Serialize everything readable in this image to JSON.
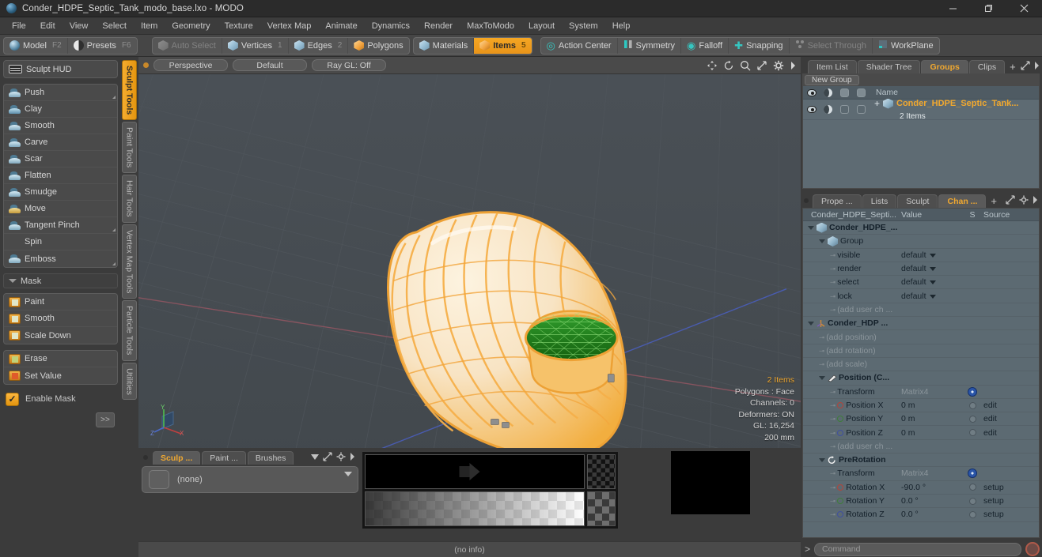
{
  "window": {
    "title": "Conder_HDPE_Septic_Tank_modo_base.lxo - MODO",
    "app_icon": "modo-sphere-icon",
    "minimize": "minimize-icon",
    "maximize": "restore-icon",
    "close": "close-icon"
  },
  "menubar": {
    "items": [
      "File",
      "Edit",
      "View",
      "Select",
      "Item",
      "Geometry",
      "Texture",
      "Vertex Map",
      "Animate",
      "Dynamics",
      "Render",
      "MaxToModo",
      "Layout",
      "System",
      "Help"
    ]
  },
  "modebar": {
    "group1": [
      {
        "label": "Model",
        "hotkey": "F2",
        "icon": "sphere-icon",
        "active": false
      },
      {
        "label": "Presets",
        "hotkey": "F6",
        "icon": "half-sphere-icon",
        "active": false
      }
    ],
    "group2": [
      {
        "label": "Auto Select",
        "hotkey": "",
        "icon": "cube-grey-icon",
        "dim": true
      },
      {
        "label": "Vertices",
        "hotkey": "1",
        "icon": "cube-icon"
      },
      {
        "label": "Edges",
        "hotkey": "2",
        "icon": "cube-icon"
      },
      {
        "label": "Polygons",
        "hotkey": "",
        "icon": "cube-orange-icon"
      }
    ],
    "group3": [
      {
        "label": "Materials",
        "hotkey": "",
        "icon": "cube-icon"
      },
      {
        "label": "Items",
        "hotkey": "5",
        "icon": "cube-orange-icon",
        "active": true
      }
    ],
    "group4": [
      {
        "label": "Action Center",
        "icon": "crosshair-icon"
      },
      {
        "label": "Symmetry",
        "icon": "symmetry-icon"
      },
      {
        "label": "Falloff",
        "icon": "falloff-icon"
      },
      {
        "label": "Snapping",
        "icon": "snap-icon"
      },
      {
        "label": "Select Through",
        "icon": "select-through-icon",
        "dim": true
      },
      {
        "label": "WorkPlane",
        "icon": "workplane-icon"
      }
    ]
  },
  "left_panel": {
    "hud_label": "Sculpt HUD",
    "hud_icon": "hud-icon",
    "sculpt_tools": [
      {
        "label": "Push",
        "icon": "push-icon",
        "corner": true
      },
      {
        "label": "Clay",
        "icon": "clay-icon"
      },
      {
        "label": "Smooth",
        "icon": "smooth-icon"
      },
      {
        "label": "Carve",
        "icon": "carve-icon"
      },
      {
        "label": "Scar",
        "icon": "scar-icon"
      },
      {
        "label": "Flatten",
        "icon": "flatten-icon"
      },
      {
        "label": "Smudge",
        "icon": "smudge-icon"
      },
      {
        "label": "Move",
        "icon": "move-icon"
      },
      {
        "label": "Tangent Pinch",
        "icon": "tangent-pinch-icon",
        "corner": true
      },
      {
        "label": "Spin",
        "icon": "spin-icon"
      },
      {
        "label": "Emboss",
        "icon": "emboss-icon",
        "corner": true
      }
    ],
    "mask_section": "Mask",
    "mask_tools": [
      {
        "label": "Paint",
        "icon": "mask-paint-icon"
      },
      {
        "label": "Smooth",
        "icon": "mask-smooth-icon"
      },
      {
        "label": "Scale Down",
        "icon": "mask-scale-down-icon"
      }
    ],
    "mask_tools2": [
      {
        "label": "Erase",
        "icon": "mask-erase-icon"
      },
      {
        "label": "Set Value",
        "icon": "mask-set-value-icon"
      }
    ],
    "enable_mask": {
      "label": "Enable Mask",
      "checked": true
    },
    "more_button": ">>",
    "vertical_tabs": [
      {
        "label": "Sculpt Tools",
        "active": true
      },
      {
        "label": "Paint Tools",
        "active": false
      },
      {
        "label": "Hair Tools",
        "active": false
      },
      {
        "label": "Vertex Map Tools",
        "active": false
      },
      {
        "label": "Particle Tools",
        "active": false
      },
      {
        "label": "Utilities",
        "active": false
      }
    ]
  },
  "viewport": {
    "buttons": [
      "Perspective",
      "Default",
      "Ray GL: Off"
    ],
    "icons": [
      "pan-icon",
      "rotate-icon",
      "zoom-icon",
      "fit-icon",
      "gear-icon",
      "chevron-right-icon"
    ],
    "stats": {
      "items": "2 Items",
      "polygons": "Polygons : Face",
      "channels": "Channels: 0",
      "deformers": "Deformers: ON",
      "gl": "GL: 16,254",
      "scale": "200 mm"
    },
    "axis": {
      "x": "X",
      "y": "Y",
      "z": "Z"
    },
    "colors": {
      "background": "#454b50",
      "model": "#f5a623",
      "cap": "#1f7a1f"
    }
  },
  "bottom_dock": {
    "tabs": [
      {
        "label": "Sculp ...",
        "active": true
      },
      {
        "label": "Paint ...",
        "active": false
      },
      {
        "label": "Brushes",
        "active": false
      }
    ],
    "preset_value": "(none)",
    "status": "(no info)"
  },
  "right_panel": {
    "top_tabs": [
      {
        "label": "Item List",
        "active": false
      },
      {
        "label": "Shader Tree",
        "active": false
      },
      {
        "label": "Groups",
        "active": true
      },
      {
        "label": "Clips",
        "active": false
      }
    ],
    "new_group_button": "New Group",
    "group_table": {
      "columns": [
        "visible-icon",
        "render-icon",
        "select-icon",
        "lock-icon",
        "Name"
      ],
      "rows": [
        {
          "name": "Conder_HDPE_Septic_Tank...",
          "sub": "2 Items"
        }
      ]
    },
    "bottom_tabs": [
      {
        "label": "Prope ...",
        "active": false
      },
      {
        "label": "Lists",
        "active": false
      },
      {
        "label": "Sculpt",
        "active": false
      },
      {
        "label": "Chan ...",
        "active": true
      }
    ],
    "channel_columns": [
      "Conder_HDPE_Septi...",
      "Value",
      "S",
      "Source"
    ],
    "channel_rows": [
      {
        "indent": 0,
        "name": "Conder_HDPE_...",
        "value": "",
        "source": "",
        "bold": true,
        "twisty": true,
        "icon": "cube-icon"
      },
      {
        "indent": 1,
        "name": "Group",
        "value": "",
        "source": "",
        "bold": false,
        "twisty": true,
        "icon": "cube-icon"
      },
      {
        "indent": 2,
        "name": "visible",
        "value": "default",
        "source": "",
        "dropdown": true
      },
      {
        "indent": 2,
        "name": "render",
        "value": "default",
        "source": "",
        "dropdown": true
      },
      {
        "indent": 2,
        "name": "select",
        "value": "default",
        "source": "",
        "dropdown": true
      },
      {
        "indent": 2,
        "name": "lock",
        "value": "default",
        "source": "",
        "dropdown": true
      },
      {
        "indent": 2,
        "name": "(add user ch ...",
        "value": "",
        "source": "",
        "dim": true
      },
      {
        "indent": 0,
        "name": "Conder_HDP ...",
        "value": "",
        "source": "",
        "bold": true,
        "twisty": true,
        "icon": "locator-icon"
      },
      {
        "indent": 1,
        "name": "(add position)",
        "value": "",
        "source": "",
        "dim": true
      },
      {
        "indent": 1,
        "name": "(add rotation)",
        "value": "",
        "source": "",
        "dim": true
      },
      {
        "indent": 1,
        "name": "(add scale)",
        "value": "",
        "source": "",
        "dim": true
      },
      {
        "indent": 1,
        "name": "Position (C...",
        "value": "",
        "source": "",
        "bold": true,
        "twisty": true,
        "icon": "position-icon"
      },
      {
        "indent": 2,
        "name": "Transform",
        "value": "Matrix4",
        "valueDim": true,
        "source": "",
        "gear": true
      },
      {
        "indent": 2,
        "name": "Position X",
        "value": "0 m",
        "source": "edit",
        "dot": "red"
      },
      {
        "indent": 2,
        "name": "Position Y",
        "value": "0 m",
        "source": "edit",
        "dot": "green"
      },
      {
        "indent": 2,
        "name": "Position Z",
        "value": "0 m",
        "source": "edit",
        "dot": "blue"
      },
      {
        "indent": 2,
        "name": "(add user ch ...",
        "value": "",
        "source": "",
        "dim": true
      },
      {
        "indent": 1,
        "name": "PreRotation",
        "value": "",
        "source": "",
        "bold": true,
        "twisty": true,
        "icon": "rotation-icon"
      },
      {
        "indent": 2,
        "name": "Transform",
        "value": "Matrix4",
        "valueDim": true,
        "source": "",
        "gear": true
      },
      {
        "indent": 2,
        "name": "Rotation X",
        "value": "-90.0 °",
        "source": "setup",
        "dot": "red"
      },
      {
        "indent": 2,
        "name": "Rotation Y",
        "value": "0.0 °",
        "source": "setup",
        "dot": "green"
      },
      {
        "indent": 2,
        "name": "Rotation Z",
        "value": "0.0 °",
        "source": "setup",
        "dot": "blue"
      }
    ],
    "command": {
      "prefix": ">",
      "placeholder": "Command",
      "value": ""
    }
  }
}
